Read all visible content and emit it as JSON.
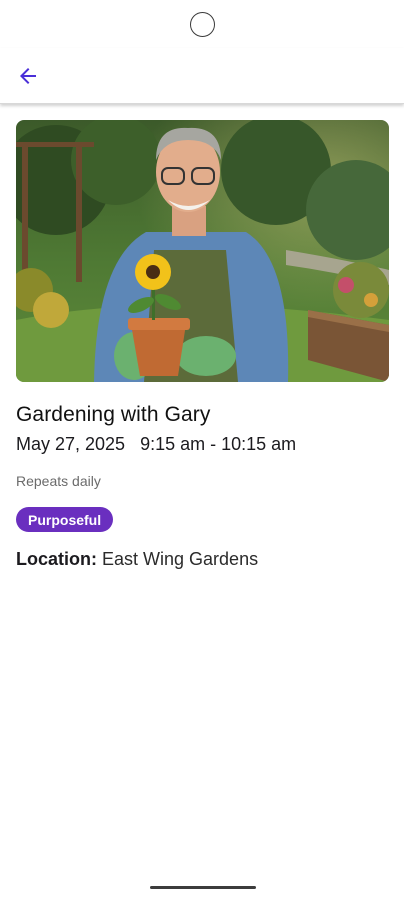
{
  "colors": {
    "accent": "#4a2fd8",
    "tag_background": "#6a2fbf",
    "tag_text": "#ffffff"
  },
  "appbar": {
    "back_icon": "arrow-left-icon"
  },
  "event": {
    "title": "Gardening with Gary",
    "date": "May 27, 2025",
    "time": "9:15 am - 10:15 am",
    "repeat": "Repeats daily",
    "tag": "Purposeful",
    "location_label": "Location:",
    "location_value": "East Wing Gardens"
  }
}
